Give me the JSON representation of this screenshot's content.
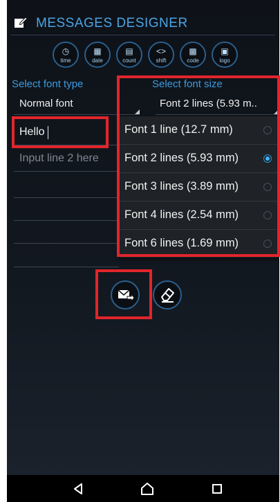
{
  "app": {
    "title": "MESSAGES DESIGNER"
  },
  "toolbar": {
    "buttons": [
      {
        "label": "time",
        "icon": "clock-icon",
        "glyph": "◷"
      },
      {
        "label": "date",
        "icon": "calendar-icon",
        "glyph": "▦"
      },
      {
        "label": "count",
        "icon": "counter-icon",
        "glyph": "▤"
      },
      {
        "label": "shift",
        "icon": "shift-icon",
        "glyph": "<>"
      },
      {
        "label": "code",
        "icon": "qr-code-icon",
        "glyph": "▩"
      },
      {
        "label": "logo",
        "icon": "image-icon",
        "glyph": "▣"
      }
    ]
  },
  "font_type": {
    "label": "Select font type",
    "value": "Normal font"
  },
  "font_size": {
    "label": "Select font size",
    "value": "Font 2 lines (5.93 m..",
    "options": [
      {
        "label": "Font 1 line (12.7 mm)",
        "selected": false
      },
      {
        "label": "Font 2 lines (5.93 mm)",
        "selected": true
      },
      {
        "label": "Font 3 lines (3.89 mm)",
        "selected": false
      },
      {
        "label": "Font 4 lines (2.54 mm)",
        "selected": false
      },
      {
        "label": "Font 6 lines (1.69 mm)",
        "selected": false
      }
    ]
  },
  "inputs": {
    "line1": {
      "value": "Hello",
      "placeholder": ""
    },
    "line2": {
      "value": "",
      "placeholder": "Input line 2 here"
    }
  },
  "actions": {
    "send_icon": "send-message-icon",
    "erase_icon": "eraser-icon"
  },
  "colors": {
    "accent": "#3d9be0",
    "highlight_box": "#e1252b",
    "radio_selected": "#48b4f5"
  }
}
